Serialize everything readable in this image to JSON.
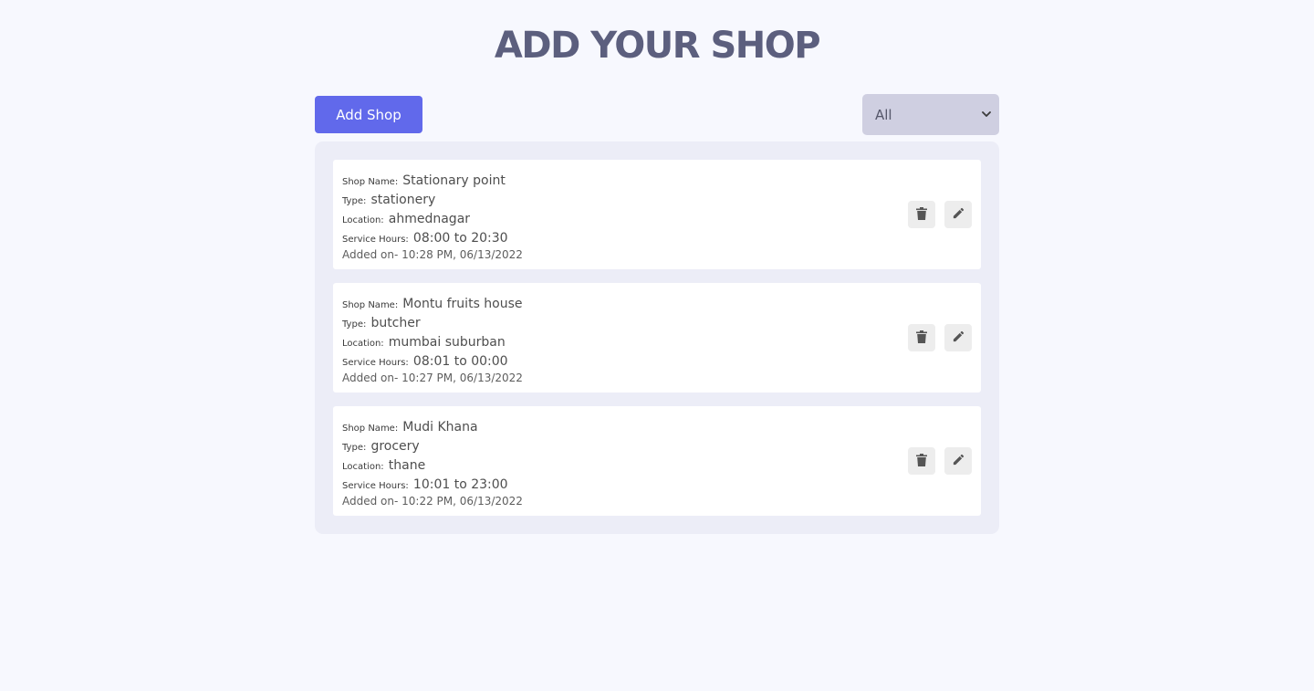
{
  "header": {
    "title": "ADD YOUR SHOP"
  },
  "toolbar": {
    "add_label": "Add Shop",
    "filter_value": "All"
  },
  "labels": {
    "name": "Shop Name:",
    "type": "Type:",
    "location": "Location:",
    "hours": "Service Hours:",
    "added_prefix": "Added on-"
  },
  "shops": [
    {
      "name": "Stationary point",
      "type": "stationery",
      "location": "ahmednagar",
      "hours": "08:00 to 20:30",
      "added": "10:28 PM, 06/13/2022"
    },
    {
      "name": "Montu fruits house",
      "type": "butcher",
      "location": "mumbai suburban",
      "hours": "08:01 to 00:00",
      "added": "10:27 PM, 06/13/2022"
    },
    {
      "name": "Mudi Khana",
      "type": "grocery",
      "location": "thane",
      "hours": "10:01 to 23:00",
      "added": "10:22 PM, 06/13/2022"
    }
  ],
  "colors": {
    "accent": "#6169eb",
    "title": "#5c5f7e",
    "background": "#f7f8fe",
    "panel": "#ecedf7",
    "select": "#cfcfe1"
  },
  "icons": {
    "delete": "trash-icon",
    "edit": "pencil-icon",
    "dropdown": "chevron-down-icon"
  }
}
